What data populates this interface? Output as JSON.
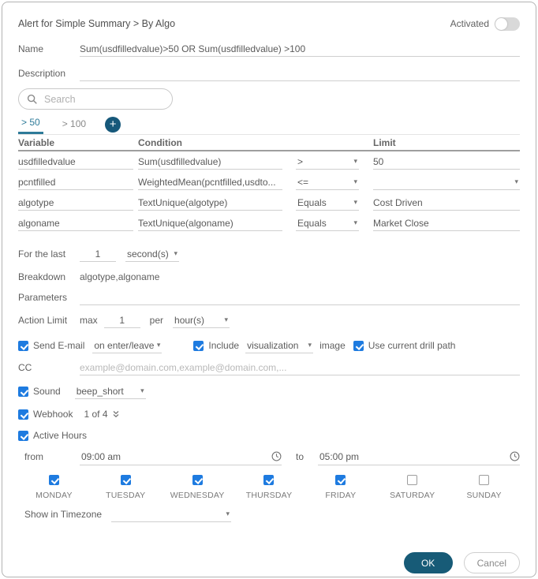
{
  "dialog": {
    "title": "Alert for Simple Summary > By Algo",
    "activated": {
      "label": "Activated",
      "on": false
    },
    "name": {
      "label": "Name",
      "value": "Sum(usdfilledvalue)>50 OR Sum(usdfilledvalue) >100"
    },
    "description": {
      "label": "Description",
      "value": ""
    },
    "search": {
      "placeholder": "Search",
      "icon": "search-icon"
    },
    "tabs": [
      {
        "label": "> 50",
        "active": true
      },
      {
        "label": "> 100",
        "active": false
      }
    ],
    "add_tab_icon": "+",
    "conditions_table": {
      "headers": {
        "variable": "Variable",
        "condition": "Condition",
        "limit": "Limit"
      },
      "rows": [
        {
          "variable": "usdfilledvalue",
          "condition": "Sum(usdfilledvalue)",
          "operator": ">",
          "limit": "50"
        },
        {
          "variable": "pcntfilled",
          "condition": "WeightedMean(pcntfilled,usdto...",
          "operator": "<=",
          "limit": ""
        },
        {
          "variable": "algotype",
          "condition": "TextUnique(algotype)",
          "operator": "Equals",
          "limit": "Cost Driven"
        },
        {
          "variable": "algoname",
          "condition": "TextUnique(algoname)",
          "operator": "Equals",
          "limit": "Market Close"
        }
      ]
    },
    "for_the_last": {
      "label": "For the last",
      "value": "1",
      "unit": "second(s)"
    },
    "breakdown": {
      "label": "Breakdown",
      "value": "algotype,algoname"
    },
    "parameters": {
      "label": "Parameters",
      "value": ""
    },
    "action_limit": {
      "label": "Action Limit",
      "max_label": "max",
      "value": "1",
      "per_label": "per",
      "unit": "hour(s)"
    },
    "email": {
      "send_label": "Send E-mail",
      "send_checked": true,
      "when": "on enter/leave",
      "include_label": "Include",
      "include_checked": true,
      "include_type": "visualization",
      "image_label": "image",
      "drill_label": "Use current drill path",
      "drill_checked": true
    },
    "cc": {
      "label": "CC",
      "placeholder": "example@domain.com,example@domain.com,..."
    },
    "sound": {
      "label": "Sound",
      "checked": true,
      "value": "beep_short"
    },
    "webhook": {
      "label": "Webhook",
      "checked": true,
      "value": "1 of 4"
    },
    "active_hours": {
      "label": "Active Hours",
      "checked": true,
      "from_label": "from",
      "from_value": "09:00 am",
      "to_label": "to",
      "to_value": "05:00 pm"
    },
    "days": [
      {
        "label": "MONDAY",
        "checked": true
      },
      {
        "label": "TUESDAY",
        "checked": true
      },
      {
        "label": "WEDNESDAY",
        "checked": true
      },
      {
        "label": "THURSDAY",
        "checked": true
      },
      {
        "label": "FRIDAY",
        "checked": true
      },
      {
        "label": "SATURDAY",
        "checked": false
      },
      {
        "label": "SUNDAY",
        "checked": false
      }
    ],
    "timezone": {
      "label": "Show in Timezone",
      "value": ""
    },
    "buttons": {
      "ok": "OK",
      "cancel": "Cancel"
    },
    "colors": {
      "accent_teal": "#16587a",
      "tab_active": "#2e7b99",
      "checkbox_blue": "#1e7be0",
      "ok_button": "#175b77",
      "border_gray": "#b3b3b3"
    }
  }
}
